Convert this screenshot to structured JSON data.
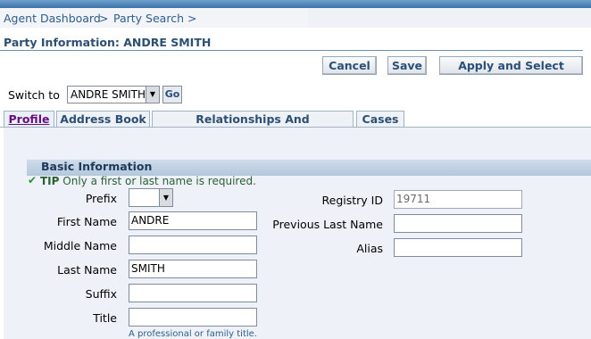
{
  "breadcrumb": {
    "items": [
      "Agent Dashboard",
      "Party Search"
    ],
    "separator": ">"
  },
  "page_title": "Party Information: ANDRE SMITH",
  "buttons": {
    "cancel": "Cancel",
    "save": "Save",
    "apply_select": "Apply and Select"
  },
  "switch_to": {
    "label": "Switch to",
    "selected": "ANDRE SMITH",
    "go": "Go"
  },
  "tabs": [
    {
      "label": "Profile",
      "active": true
    },
    {
      "label": "Address Book",
      "active": false
    },
    {
      "label": "Relationships And Classifications",
      "active": false
    },
    {
      "label": "Cases",
      "active": false
    }
  ],
  "section": {
    "title": "Basic Information",
    "tip_prefix": "TIP",
    "tip_text": "Only a first or last name is required."
  },
  "form_left": {
    "prefix": {
      "label": "Prefix",
      "value": ""
    },
    "first_name": {
      "label": "First Name",
      "value": "ANDRE"
    },
    "middle_name": {
      "label": "Middle Name",
      "value": ""
    },
    "last_name": {
      "label": "Last Name",
      "value": "SMITH"
    },
    "suffix": {
      "label": "Suffix",
      "value": ""
    },
    "title": {
      "label": "Title",
      "value": "",
      "hint": "A professional or family title."
    }
  },
  "form_right": {
    "registry_id": {
      "label": "Registry ID",
      "value": "19711"
    },
    "previous_last_name": {
      "label": "Previous Last Name",
      "value": ""
    },
    "alias": {
      "label": "Alias",
      "value": ""
    }
  },
  "colors": {
    "link": "#2d5d8f",
    "active_tab": "#6b0f80",
    "section_header": "#b3c7dc",
    "panel": "#eef2f8"
  }
}
